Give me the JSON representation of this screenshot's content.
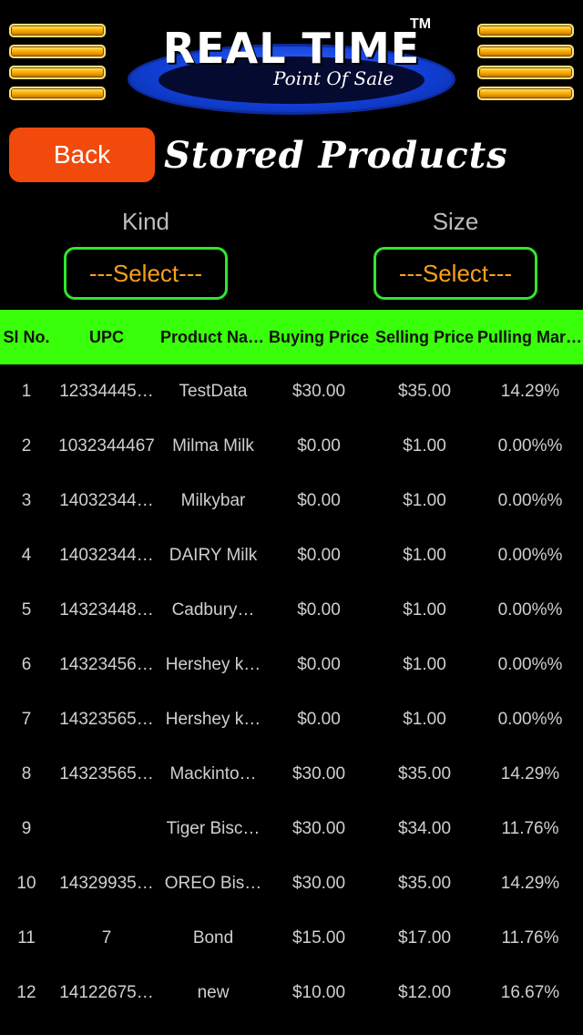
{
  "header": {
    "logo_title": "REAL TIME",
    "logo_tm": "TM",
    "logo_subtitle": "Point Of Sale"
  },
  "nav": {
    "back_label": "Back",
    "page_title": "Stored Products"
  },
  "filters": {
    "kind_label": "Kind",
    "kind_value": "---Select---",
    "size_label": "Size",
    "size_value": "---Select---"
  },
  "colors": {
    "back_button": "#f14a0c",
    "header_row": "#3aff0a",
    "select_border": "#31e62c",
    "select_text": "#f7a01a"
  },
  "table": {
    "columns": [
      "Sl No.",
      "UPC",
      "Product Name",
      "Buying Price",
      "Selling Price",
      "Pulling Margin"
    ],
    "rows": [
      [
        "1",
        "12334445…",
        "TestData",
        "$30.00",
        "$35.00",
        "14.29%"
      ],
      [
        "2",
        "1032344467",
        "Milma Milk",
        "$0.00",
        "$1.00",
        "0.00%%"
      ],
      [
        "3",
        "14032344…",
        "Milkybar",
        "$0.00",
        "$1.00",
        "0.00%%"
      ],
      [
        "4",
        "14032344…",
        "DAIRY Milk",
        "$0.00",
        "$1.00",
        "0.00%%"
      ],
      [
        "5",
        "14323448…",
        "Cadbury…",
        "$0.00",
        "$1.00",
        "0.00%%"
      ],
      [
        "6",
        "14323456…",
        "Hershey k…",
        "$0.00",
        "$1.00",
        "0.00%%"
      ],
      [
        "7",
        "14323565…",
        "Hershey k…",
        "$0.00",
        "$1.00",
        "0.00%%"
      ],
      [
        "8",
        "14323565…",
        "Mackinto…",
        "$30.00",
        "$35.00",
        "14.29%"
      ],
      [
        "9",
        "",
        "Tiger Bisc…",
        "$30.00",
        "$34.00",
        "11.76%"
      ],
      [
        "10",
        "14329935…",
        "OREO Bis…",
        "$30.00",
        "$35.00",
        "14.29%"
      ],
      [
        "11",
        "7",
        "Bond",
        "$15.00",
        "$17.00",
        "11.76%"
      ],
      [
        "12",
        "14122675…",
        "new",
        "$10.00",
        "$12.00",
        "16.67%"
      ]
    ]
  }
}
